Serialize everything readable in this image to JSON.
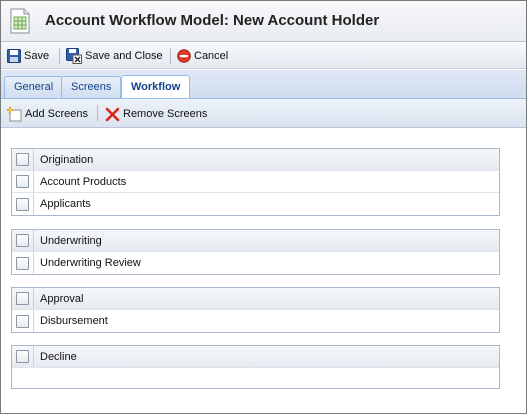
{
  "window": {
    "title": "Account Workflow Model: New Account Holder",
    "title_icon": "spreadsheet-document-icon"
  },
  "toolbar": {
    "save_label": "Save",
    "save_close_label": "Save and Close",
    "cancel_label": "Cancel"
  },
  "tabs": [
    {
      "label": "General",
      "active": false
    },
    {
      "label": "Screens",
      "active": false
    },
    {
      "label": "Workflow",
      "active": true
    }
  ],
  "subtoolbar": {
    "add_label": "Add Screens",
    "remove_label": "Remove Screens"
  },
  "groups": [
    {
      "items": [
        {
          "label": "Origination",
          "checked": false
        },
        {
          "label": "Account Products",
          "checked": false
        },
        {
          "label": "Applicants",
          "checked": false
        }
      ]
    },
    {
      "items": [
        {
          "label": "Underwriting",
          "checked": false
        },
        {
          "label": "Underwriting Review",
          "checked": false
        }
      ]
    },
    {
      "items": [
        {
          "label": "Approval",
          "checked": false
        },
        {
          "label": "Disbursement",
          "checked": false
        }
      ]
    },
    {
      "items": [
        {
          "label": "Decline",
          "checked": false
        }
      ]
    }
  ],
  "colors": {
    "tab_text": "#15428b",
    "border": "#99bbe8"
  }
}
